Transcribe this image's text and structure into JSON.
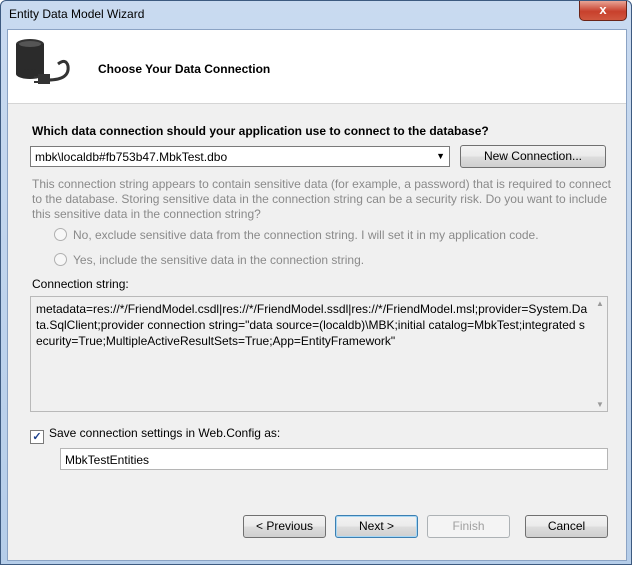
{
  "window": {
    "title": "Entity Data Model Wizard",
    "close_glyph": "x"
  },
  "header": {
    "title": "Choose Your Data Connection",
    "icon": "database-plug-icon"
  },
  "question": "Which data connection should your application use to connect to the database?",
  "connection_select": {
    "value": "mbk\\localdb#fb753b47.MbkTest.dbo",
    "arrow": "▼"
  },
  "new_connection_button": "New Connection...",
  "sensitive_text": "This connection string appears to contain sensitive data (for example, a password) that is required to connect to the database. Storing sensitive data in the connection string can be a security risk. Do you want to include this sensitive data in the connection string?",
  "radio_options": [
    "No, exclude sensitive data from the connection string. I will set it in my application code.",
    "Yes, include the sensitive data in the connection string."
  ],
  "connection_string_label": "Connection string:",
  "connection_string": "metadata=res://*/FriendModel.csdl|res://*/FriendModel.ssdl|res://*/FriendModel.msl;provider=System.Data.SqlClient;provider connection string=\"data source=(localdb)\\MBK;initial catalog=MbkTest;integrated security=True;MultipleActiveResultSets=True;App=EntityFramework\"",
  "save_settings": {
    "checked": true,
    "check_glyph": "✓",
    "label": "Save connection settings in Web.Config as:"
  },
  "entities_name": "MbkTestEntities",
  "buttons": {
    "previous": "< Previous",
    "next": "Next >",
    "finish": "Finish",
    "cancel": "Cancel"
  },
  "colors": {
    "title_bar": "#c9daf0",
    "close_button": "#c8402c",
    "disabled_text": "#8a8a8a"
  }
}
